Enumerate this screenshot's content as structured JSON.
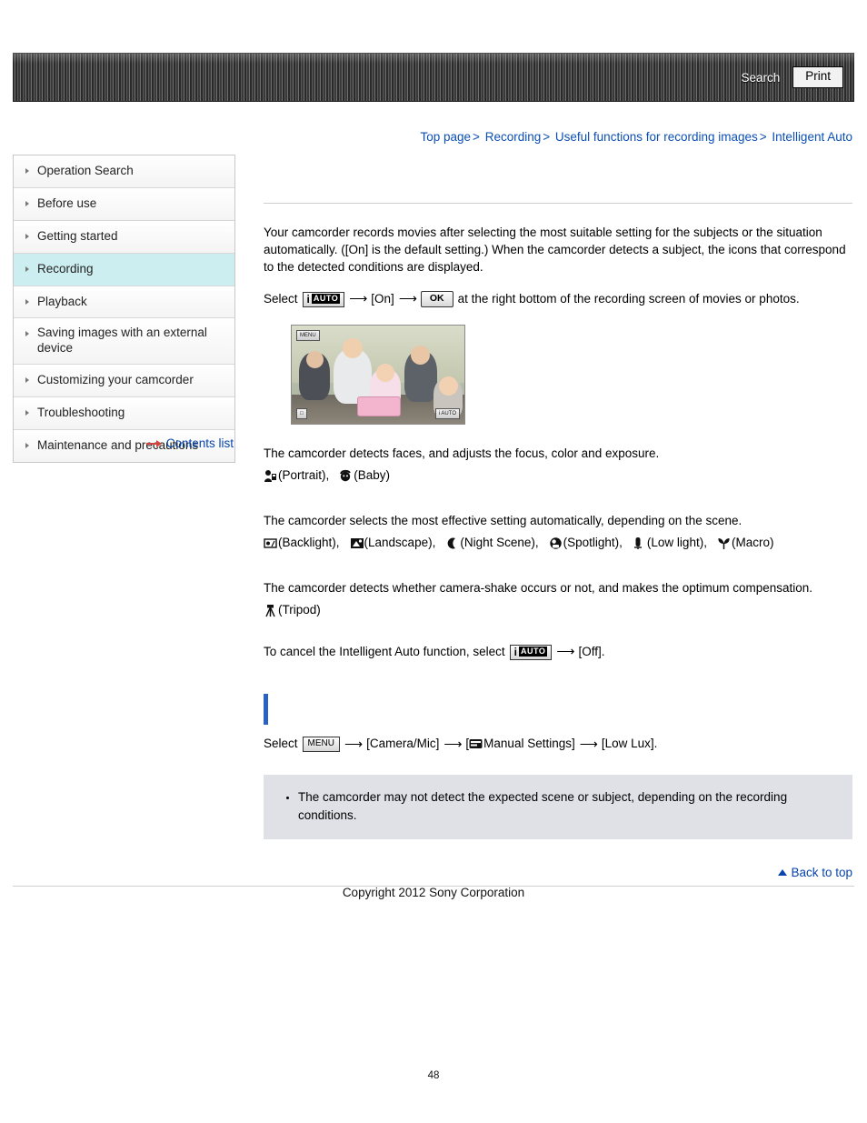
{
  "header": {
    "search_label": "Search",
    "print_label": "Print"
  },
  "breadcrumb": {
    "items": [
      "Top page",
      "Recording",
      "Useful functions for recording images",
      "Intelligent Auto"
    ],
    "separator": ">"
  },
  "sidebar": {
    "items": [
      {
        "label": "Operation Search",
        "active": false
      },
      {
        "label": "Before use",
        "active": false
      },
      {
        "label": "Getting started",
        "active": false
      },
      {
        "label": "Recording",
        "active": true
      },
      {
        "label": "Playback",
        "active": false
      },
      {
        "label": "Saving images with an external device",
        "active": false
      },
      {
        "label": "Customizing your camcorder",
        "active": false
      },
      {
        "label": "Troubleshooting",
        "active": false
      },
      {
        "label": "Maintenance and precautions",
        "active": false
      }
    ],
    "contents_link": "Contents list"
  },
  "content": {
    "intro": "Your camcorder records movies after selecting the most suitable setting for the subjects or the situation automatically. ([On] is the default setting.) When the camcorder detects a subject, the icons that correspond to the detected conditions are displayed.",
    "select_line": {
      "select_label": "Select",
      "iauto_i": "i",
      "iauto_auto": "AUTO",
      "on_label": "[On]",
      "ok_label": "OK",
      "tail": "at the right bottom of the recording screen of movies or photos."
    },
    "photo": {
      "menu_badge": "MENU",
      "left_badge": "□",
      "right_badge": "i AUTO"
    },
    "faces_para": "The camcorder detects faces, and adjusts the focus, color and exposure.",
    "faces_icons": [
      {
        "icon": "portrait-icon",
        "label": "(Portrait),"
      },
      {
        "icon": "baby-icon",
        "label": "(Baby)"
      }
    ],
    "scene_para": "The camcorder selects the most effective setting automatically, depending on the scene.",
    "scene_icons": [
      {
        "icon": "backlight-icon",
        "label": "(Backlight),"
      },
      {
        "icon": "landscape-icon",
        "label": "(Landscape),"
      },
      {
        "icon": "night-scene-icon",
        "label": "(Night Scene),"
      },
      {
        "icon": "spotlight-icon",
        "label": "(Spotlight),"
      },
      {
        "icon": "low-light-icon",
        "label": "(Low light),"
      },
      {
        "icon": "macro-icon",
        "label": "(Macro)"
      }
    ],
    "shake_para": "The camcorder detects whether camera-shake occurs or not, and makes the optimum compensation.",
    "shake_icons": [
      {
        "icon": "tripod-icon",
        "label": "(Tripod)"
      }
    ],
    "cancel_line": {
      "prefix": "To cancel the Intelligent Auto function, select",
      "iauto_i": "i",
      "iauto_auto": "AUTO",
      "off_label": "[Off]."
    },
    "menu_line": {
      "select_label": "Select",
      "menu_label": "MENU",
      "camera_mic": "[Camera/Mic]",
      "manual_open": "[",
      "manual_icon": "manual-settings-icon",
      "manual_settings": "Manual Settings]",
      "low_lux": "[Low Lux]."
    },
    "note": "The camcorder may not detect the expected scene or subject, depending on the recording conditions."
  },
  "footer": {
    "back_to_top": "Back to top",
    "copyright": "Copyright 2012 Sony Corporation",
    "page_number": "48"
  }
}
